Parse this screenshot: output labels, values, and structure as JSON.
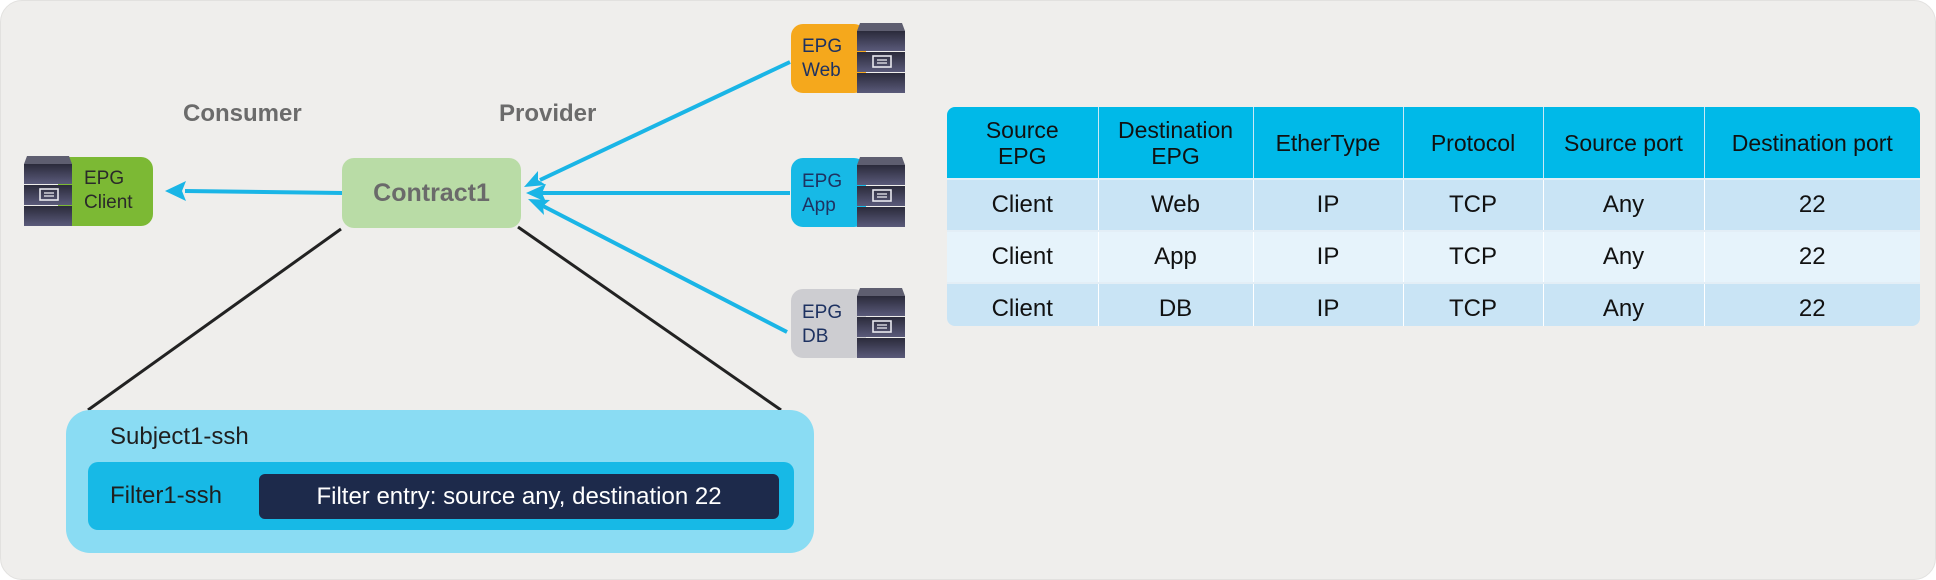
{
  "labels": {
    "consumer": "Consumer",
    "provider": "Provider"
  },
  "contract": {
    "name": "Contract1"
  },
  "epgs": {
    "client": {
      "line1": "EPG",
      "line2": "Client",
      "color": "#7cb934"
    },
    "web": {
      "line1": "EPG",
      "line2": "Web",
      "color": "#f5a81c"
    },
    "app": {
      "line1": "EPG",
      "line2": "App",
      "color": "#17b9e6"
    },
    "db": {
      "line1": "EPG",
      "line2": "DB",
      "color": "#cdcdd1"
    }
  },
  "subject": {
    "name": "Subject1-ssh",
    "filter": {
      "name": "Filter1-ssh",
      "entry": "Filter entry: source any, destination 22"
    }
  },
  "colors": {
    "arrow": "#1ab5e6",
    "connector": "#222222"
  },
  "table": {
    "headers": [
      "Source EPG",
      "Destination EPG",
      "EtherType",
      "Protocol",
      "Source port",
      "Destination port"
    ],
    "rows": [
      [
        "Client",
        "Web",
        "IP",
        "TCP",
        "Any",
        "22"
      ],
      [
        "Client",
        "App",
        "IP",
        "TCP",
        "Any",
        "22"
      ],
      [
        "Client",
        "DB",
        "IP",
        "TCP",
        "Any",
        "22"
      ]
    ]
  }
}
